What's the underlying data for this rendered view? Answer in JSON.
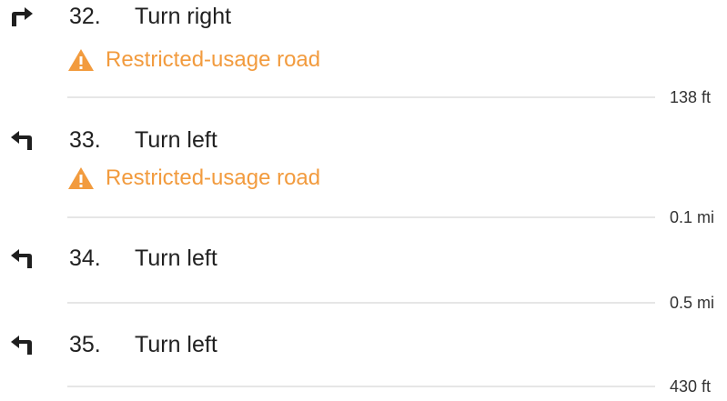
{
  "steps": [
    {
      "number": "32.",
      "instruction": "Turn right",
      "icon": "turn-right-icon",
      "warning": "Restricted-usage road",
      "distance": "138 ft"
    },
    {
      "number": "33.",
      "instruction": "Turn left",
      "icon": "turn-left-icon",
      "warning": "Restricted-usage road",
      "distance": "0.1 mi"
    },
    {
      "number": "34.",
      "instruction": "Turn left",
      "icon": "turn-left-icon",
      "distance": "0.5 mi"
    },
    {
      "number": "35.",
      "instruction": "Turn left",
      "icon": "turn-left-icon",
      "distance": "430 ft"
    }
  ],
  "colors": {
    "warning": "#f29b3e",
    "text": "#212121",
    "divider": "#e6e6e6"
  }
}
